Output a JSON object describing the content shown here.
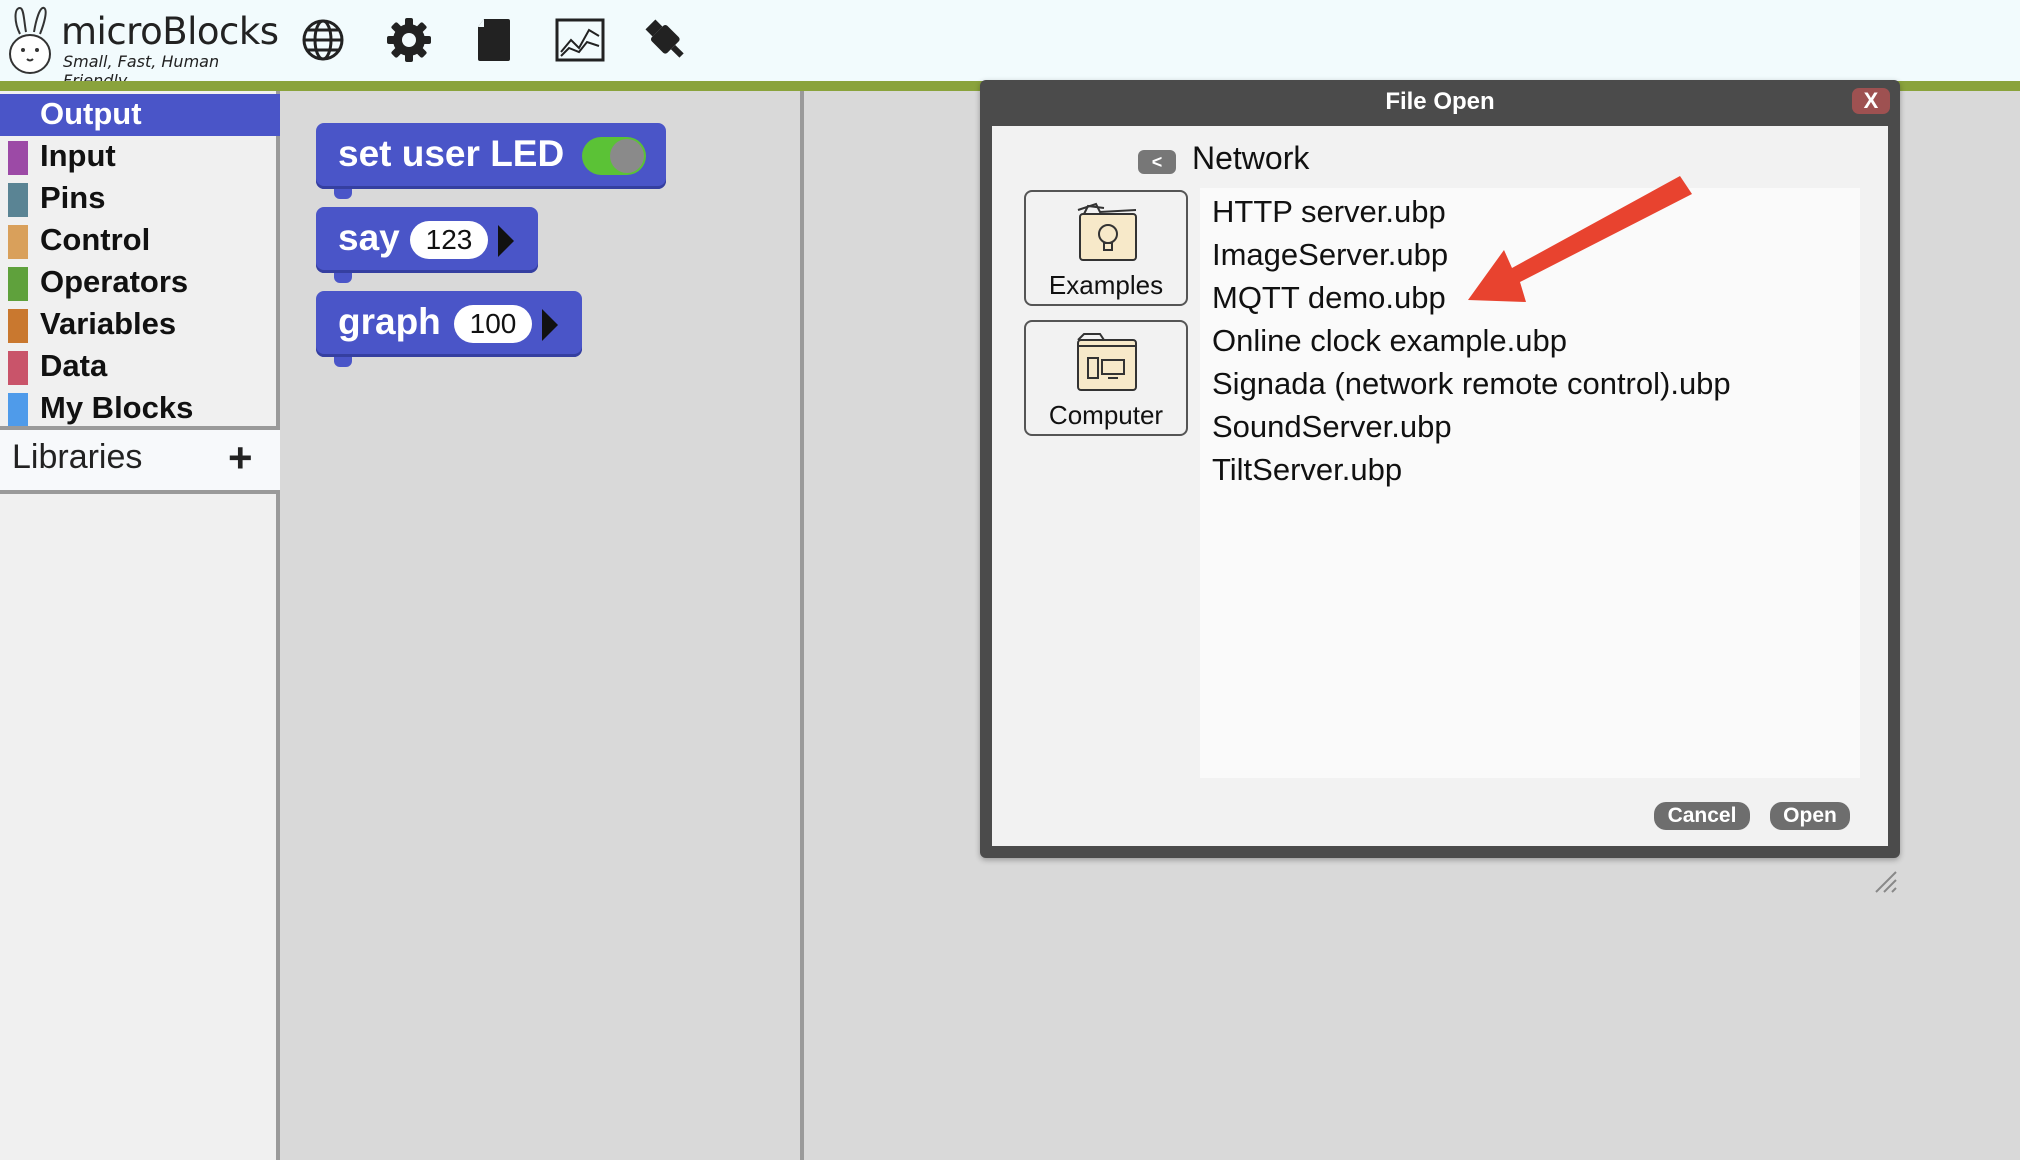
{
  "app": {
    "name": "microBlocks",
    "tagline": "Small, Fast, Human Friendly"
  },
  "toolbar": {
    "icons": [
      {
        "name": "globe-icon"
      },
      {
        "name": "gear-icon"
      },
      {
        "name": "file-icon"
      },
      {
        "name": "graph-icon"
      },
      {
        "name": "usb-icon"
      }
    ]
  },
  "palette": {
    "categories": [
      {
        "label": "Output",
        "color": "#4a55c8",
        "selected": true
      },
      {
        "label": "Input",
        "color": "#9c4aa6"
      },
      {
        "label": "Pins",
        "color": "#5a8494"
      },
      {
        "label": "Control",
        "color": "#d9a05b"
      },
      {
        "label": "Operators",
        "color": "#5fa13c"
      },
      {
        "label": "Variables",
        "color": "#c9782f"
      },
      {
        "label": "Data",
        "color": "#c9546a"
      },
      {
        "label": "My Blocks",
        "color": "#4f9bea"
      }
    ],
    "libraries_label": "Libraries",
    "add_label": "+"
  },
  "blocks": {
    "set_user_led": "set user LED",
    "say": "say",
    "say_value": "123",
    "graph": "graph",
    "graph_value": "100"
  },
  "dialog": {
    "title": "File Open",
    "close_label": "X",
    "back_label": "<",
    "folder": "Network",
    "sources": [
      {
        "label": "Examples"
      },
      {
        "label": "Computer"
      }
    ],
    "files": [
      "HTTP server.ubp",
      "ImageServer.ubp",
      "MQTT demo.ubp",
      "Online clock example.ubp",
      "Signada (network remote control).ubp",
      "SoundServer.ubp",
      "TiltServer.ubp"
    ],
    "cancel_label": "Cancel",
    "open_label": "Open"
  },
  "colors": {
    "accent": "#4a55c8",
    "topbar_line": "#8aa33c",
    "arrow": "#e8432f",
    "toggle_on": "#5bc236"
  }
}
